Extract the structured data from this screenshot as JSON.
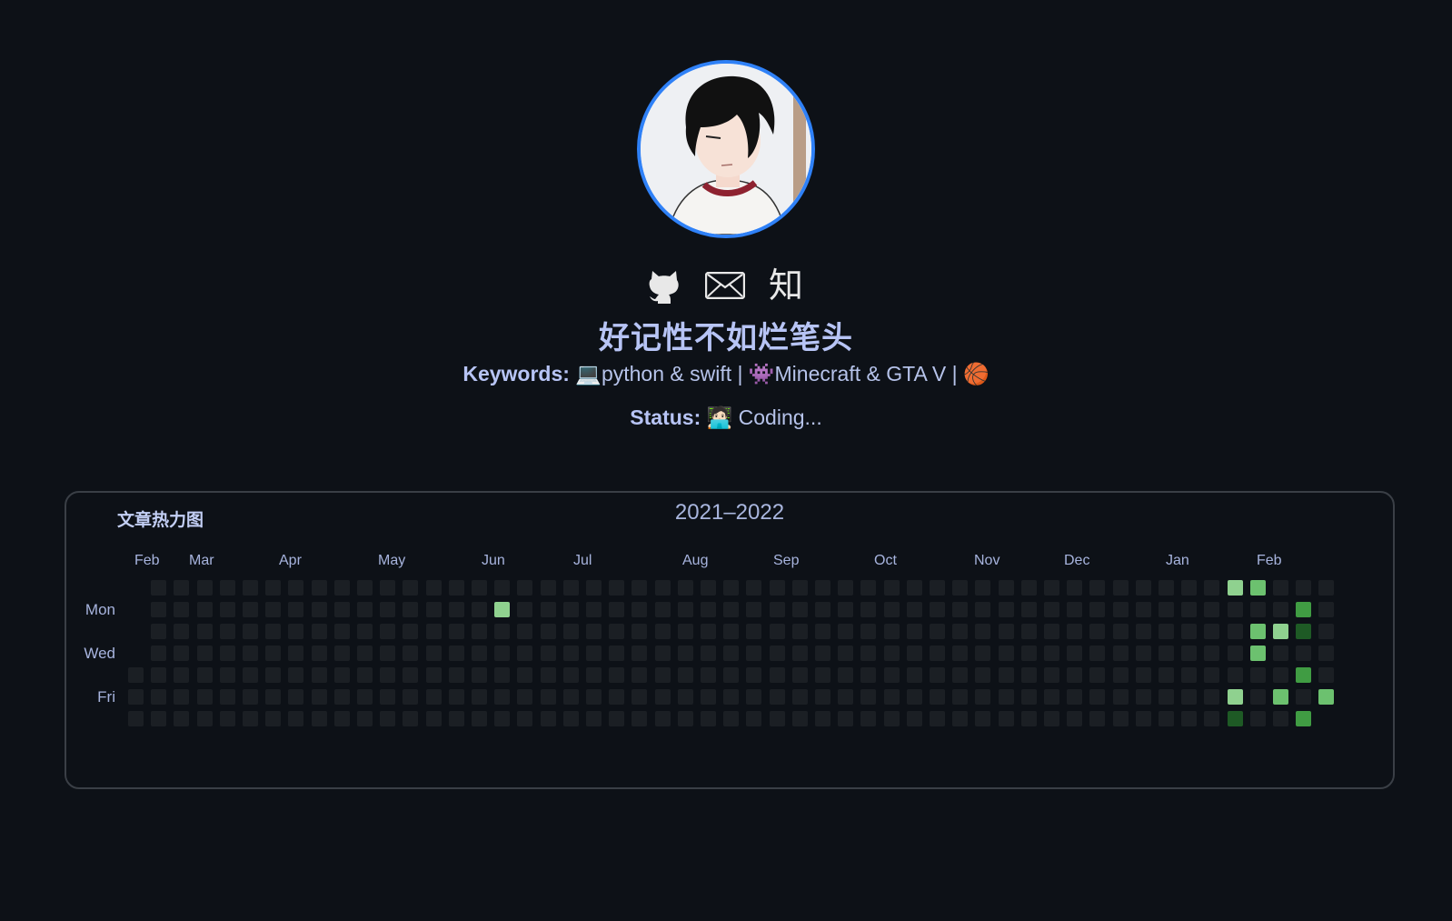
{
  "profile": {
    "name": "好记性不如烂笔头",
    "links": [
      {
        "icon": "github-icon",
        "label": ""
      },
      {
        "icon": "mail-icon",
        "label": ""
      },
      {
        "icon": "zhihu-icon",
        "label": "知"
      }
    ],
    "keywords_label": "Keywords:",
    "keywords_text": "python & swift | 👾Minecraft & GTA V | 🏀",
    "keywords_emoji": "💻",
    "status_label": "Status:",
    "status_emoji": "🧑🏻‍💻",
    "status_text": "Coding..."
  },
  "heatmap": {
    "title": "文章热力图",
    "year_range": "2021–2022",
    "months": [
      "Feb",
      "Mar",
      "Apr",
      "May",
      "Jun",
      "Jul",
      "Aug",
      "Sep",
      "Oct",
      "Nov",
      "Dec",
      "Jan",
      "Feb"
    ],
    "days": [
      "Mon",
      "Wed",
      "Fri"
    ],
    "weeks": 53,
    "colors": {
      "empty": "#1b1f24",
      "level1": "#9be9a8",
      "level2": "#8fd18f",
      "level3": "#6cc16f",
      "level4": "#409c43",
      "level5": "#1e5a25"
    },
    "active_cells": [
      {
        "week": 16,
        "day": 1,
        "level": 2
      },
      {
        "week": 48,
        "day": 0,
        "level": 2
      },
      {
        "week": 49,
        "day": 0,
        "level": 3
      },
      {
        "week": 51,
        "day": 1,
        "level": 4
      },
      {
        "week": 49,
        "day": 2,
        "level": 3
      },
      {
        "week": 50,
        "day": 2,
        "level": 2
      },
      {
        "week": 51,
        "day": 2,
        "level": 5
      },
      {
        "week": 49,
        "day": 3,
        "level": 3
      },
      {
        "week": 51,
        "day": 4,
        "level": 4
      },
      {
        "week": 48,
        "day": 5,
        "level": 2
      },
      {
        "week": 50,
        "day": 5,
        "level": 3
      },
      {
        "week": 52,
        "day": 5,
        "level": 3
      },
      {
        "week": 48,
        "day": 6,
        "level": 5
      },
      {
        "week": 51,
        "day": 6,
        "level": 4
      }
    ]
  }
}
